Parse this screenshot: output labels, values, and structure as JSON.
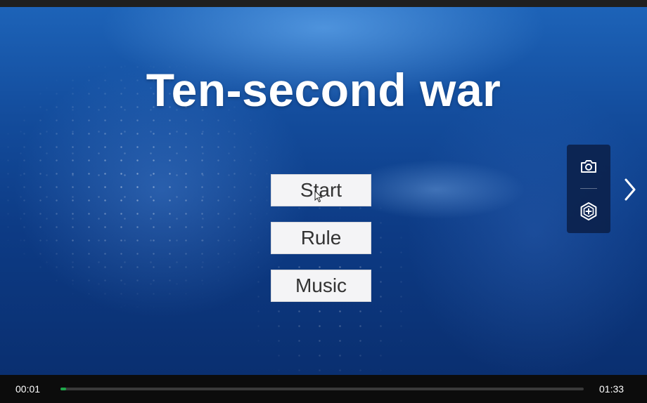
{
  "game": {
    "title": "Ten-second war",
    "menu": {
      "start_label": "Start",
      "rule_label": "Rule",
      "music_label": "Music"
    }
  },
  "toolbar": {
    "icons": [
      "camera-icon",
      "ai-enhance-icon"
    ],
    "next_icon": "chevron-right-icon"
  },
  "player": {
    "current_time": "00:01",
    "total_time": "01:33",
    "progress_fraction": 0.011,
    "progress_color": "#1ea84a"
  },
  "colors": {
    "button_bg": "#f4f4f6",
    "button_text": "#333333",
    "title_text": "#ffffff"
  }
}
